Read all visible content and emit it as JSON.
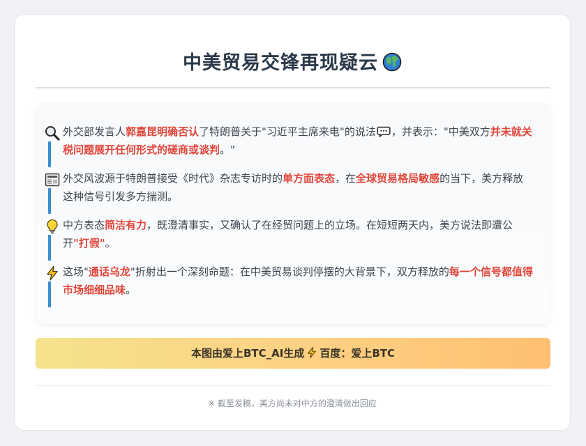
{
  "header": {
    "title": "中美贸易交锋再现疑云",
    "title_icon": "globe-icon"
  },
  "paragraphs": [
    {
      "icon": "magnifier-icon",
      "segments": [
        {
          "t": "外交部发言人",
          "h": false
        },
        {
          "t": "郭嘉昆明确否认",
          "h": true
        },
        {
          "t": "了特朗普关于\"习近平主席来电\"的说法",
          "h": false
        },
        {
          "t": "",
          "icon": "speech-bubble-icon"
        },
        {
          "t": "，并表示：\"中美双方",
          "h": false
        },
        {
          "t": "并未就关税问题展开任何形式的磋商或谈判",
          "h": true
        },
        {
          "t": "。\"",
          "h": false
        }
      ]
    },
    {
      "icon": "newspaper-icon",
      "segments": [
        {
          "t": "外交风波源于特朗普接受《时代》杂志专访时的",
          "h": false
        },
        {
          "t": "单方面表态",
          "h": true
        },
        {
          "t": "，在",
          "h": false
        },
        {
          "t": "全球贸易格局敏感",
          "h": true
        },
        {
          "t": "的当下，美方释放这种信号引发多方揣测。",
          "h": false
        }
      ]
    },
    {
      "icon": "lightbulb-icon",
      "segments": [
        {
          "t": "中方表态",
          "h": false
        },
        {
          "t": "简洁有力",
          "h": true
        },
        {
          "t": "，既澄清事实，又确认了在经贸问题上的立场。在短短两天内，美方说法即遭公开",
          "h": false
        },
        {
          "t": "\"打假\"",
          "h": true
        },
        {
          "t": "。",
          "h": false
        }
      ]
    },
    {
      "icon": "lightning-icon",
      "segments": [
        {
          "t": "这场\"",
          "h": false
        },
        {
          "t": "通话乌龙",
          "h": true
        },
        {
          "t": "\"折射出一个深刻命题：在中美贸易谈判停摆的大背景下，双方释放的",
          "h": false
        },
        {
          "t": "每一个信号都值得市场细细品味",
          "h": true
        },
        {
          "t": "。",
          "h": false
        }
      ]
    }
  ],
  "banner": {
    "left_text": "本图由爱上BTC_AI生成",
    "icon": "lightning-icon",
    "right_text": "百度：爱上BTC"
  },
  "footnote": "※ 截至发稿，美方尚未对中方的澄清做出回应",
  "colors": {
    "highlight": "#e0463a",
    "bar": "#3a8ed0",
    "title": "#2b3a4a"
  }
}
